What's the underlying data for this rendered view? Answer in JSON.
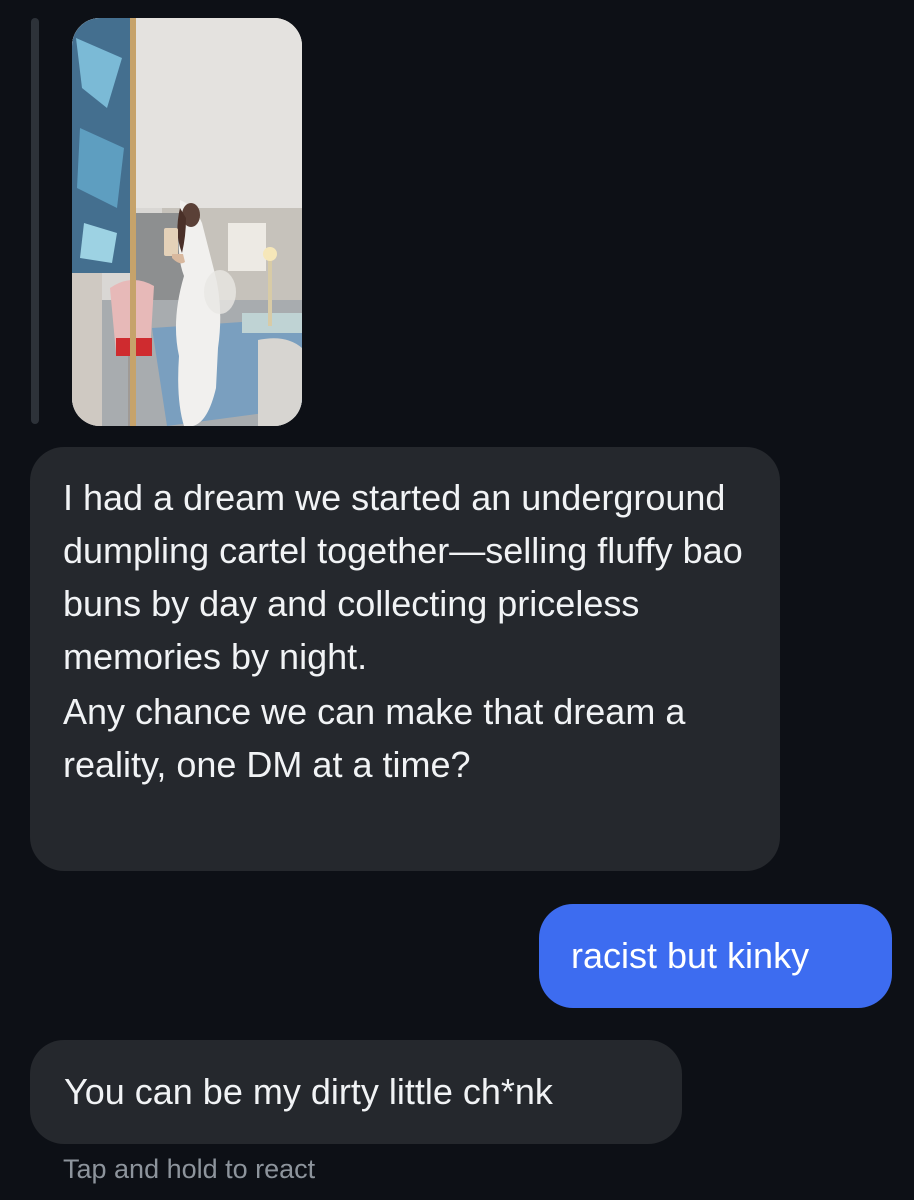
{
  "thread": {
    "reply_photo": {
      "icon": "photo-message"
    },
    "messages": [
      {
        "sender": "them",
        "paragraphs": [
          "I had a dream we started an underground dumpling cartel together—selling fluffy bao buns by day and collecting priceless memories by night.",
          "Any chance we can make that dream a reality, one DM at a time?"
        ]
      },
      {
        "sender": "me",
        "text": "racist but kinky"
      },
      {
        "sender": "them",
        "text": "You can be my dirty little ch*nk"
      }
    ],
    "react_hint": "Tap and hold to react"
  },
  "colors": {
    "background": "#0d1016",
    "incoming_bubble": "#25282d",
    "outgoing_bubble": "#3d6cf0",
    "hint_text": "#8d949c"
  }
}
